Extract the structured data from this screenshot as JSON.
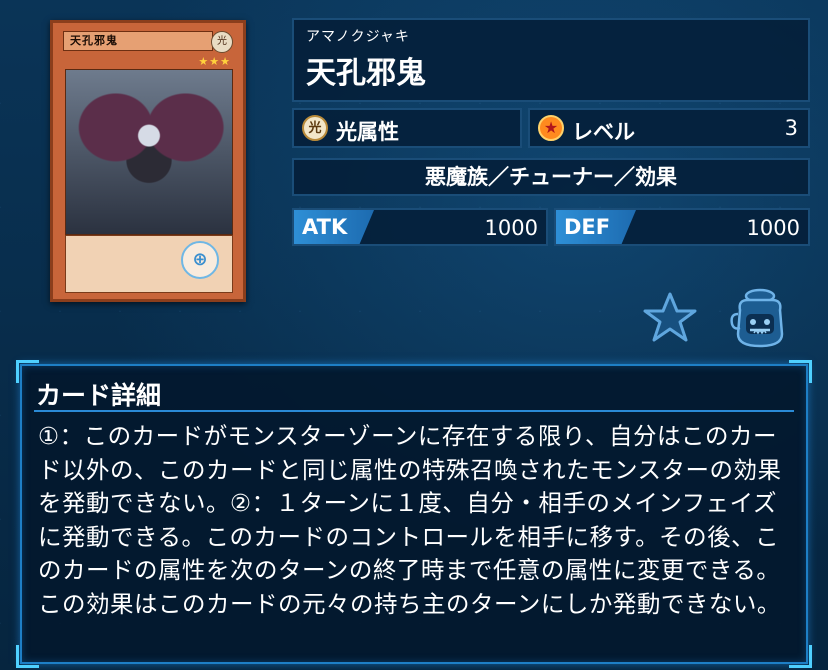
{
  "card": {
    "ruby": "アマノクジャキ",
    "name": "天孔邪鬼",
    "attribute_icon_glyph": "光",
    "attribute": "光属性",
    "level_label": "レベル",
    "level_value": "3",
    "type_line": "悪魔族／チューナー／効果",
    "atk_label": "ATK",
    "atk_value": "1000",
    "def_label": "DEF",
    "def_value": "1000",
    "image": {
      "name_text": "天孔邪鬼",
      "attr_glyph": "光",
      "stars": "★★★"
    }
  },
  "actions": {
    "favorite_icon": "star-icon",
    "deck_icon": "pot-of-greed-icon"
  },
  "details": {
    "title": "カード詳細",
    "text": "①：このカードがモンスターゾーンに存在する限り、自分はこのカード以外の、このカードと同じ属性の特殊召喚されたモンスターの効果を発動できない。②：１ターンに１度、自分・相手のメインフェイズに発動できる。このカードのコントロールを相手に移す。その後、このカードの属性を次のターンの終了時まで任意の属性に変更できる。この効果はこのカードの元々の持ち主のターンにしか発動できない。"
  },
  "colors": {
    "background": "#062a4a",
    "panel": "#041f3a",
    "accent": "#2e8fd6",
    "card_frame": "#c8653a"
  }
}
